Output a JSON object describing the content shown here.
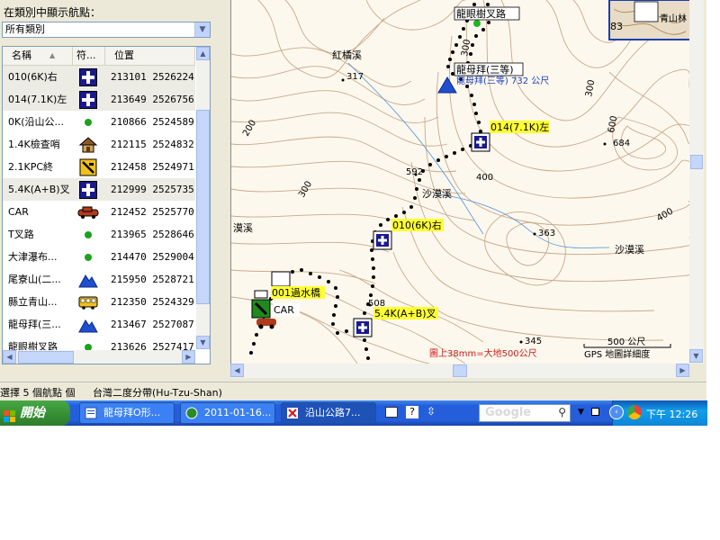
{
  "left_panel": {
    "category_label": "在類別中顯示航點：",
    "category_selected": "所有類別",
    "columns": {
      "name": "名稱",
      "symbol": "符...",
      "position": "位置"
    },
    "waypoints": [
      {
        "name": "010(6K)右",
        "symbol": "first-aid-icon",
        "position": "213101 2526224",
        "selected": true
      },
      {
        "name": "014(7.1K)左",
        "symbol": "first-aid-icon",
        "position": "213649 2526756",
        "selected": true
      },
      {
        "name": "0K(沿山公...",
        "symbol": "green-dot-icon",
        "position": "210866 2524589",
        "selected": false
      },
      {
        "name": "1.4K檢查哨",
        "symbol": "house-icon",
        "position": "212115 2524832",
        "selected": false
      },
      {
        "name": "2.1KPC終",
        "symbol": "trailhead-icon",
        "position": "212458 2524971",
        "selected": false
      },
      {
        "name": "5.4K(A+B)叉",
        "symbol": "first-aid-icon",
        "position": "212999 2525735",
        "selected": true
      },
      {
        "name": "CAR",
        "symbol": "car-icon",
        "position": "212452 2525770",
        "selected": false
      },
      {
        "name": "T叉路",
        "symbol": "green-dot-icon",
        "position": "213965 2528646",
        "selected": false
      },
      {
        "name": "大津瀑布...",
        "symbol": "green-dot-icon",
        "position": "214470 2529004",
        "selected": false
      },
      {
        "name": "尾寮山(二...",
        "symbol": "summit-icon",
        "position": "215950 2528721",
        "selected": false
      },
      {
        "name": "縣立青山...",
        "symbol": "bus-icon",
        "position": "212350 2524329",
        "selected": false
      },
      {
        "name": "龍母拜(三...",
        "symbol": "summit-icon",
        "position": "213467 2527087",
        "selected": false
      },
      {
        "name": "龍眼樹叉路",
        "symbol": "green-dot-icon",
        "position": "213626 2527417",
        "selected": false
      }
    ]
  },
  "map": {
    "labels": {
      "longan_junction": "龍眼樹叉路",
      "hongjuxi": "紅橘溪",
      "elev_317": "317",
      "longmubai": "龍母拜(三等)",
      "longmubai_elev": "龍母拜(三等) 732 公尺",
      "wp_014": "014(7.1K)左",
      "wp_010": "010(6K)右",
      "wp_001": "001過水橋",
      "wp_54k": "5.4K(A+B)叉",
      "car": "CAR",
      "shamoxi1": "沙漠溪",
      "shamoxi2": "沙漠溪",
      "moxi": "漠溪",
      "e592": "592",
      "e400a": "400",
      "e300a": "300",
      "e200": "200",
      "e300b": "300",
      "e600": "600",
      "e684": "684",
      "e400b": "400",
      "e363": "363",
      "e508": "508",
      "e345": "345",
      "e300c": "300",
      "scale_label": "500 公尺",
      "scale_note": "圖上38mm=大地500公尺",
      "detail_note": "GPS 地圖詳細度",
      "e83": "83",
      "minimap_text": "青山林"
    }
  },
  "status": {
    "selection": "選擇 5 個航點 個",
    "datum": "台灣二度分帶(Hu-Tzu-Shan)"
  },
  "taskbar": {
    "start": "開始",
    "tasks": [
      "龍母拜O形...",
      "2011-01-16...",
      "沿山公路7..."
    ],
    "search_logo": "Google",
    "clock": "下午 12:26"
  }
}
